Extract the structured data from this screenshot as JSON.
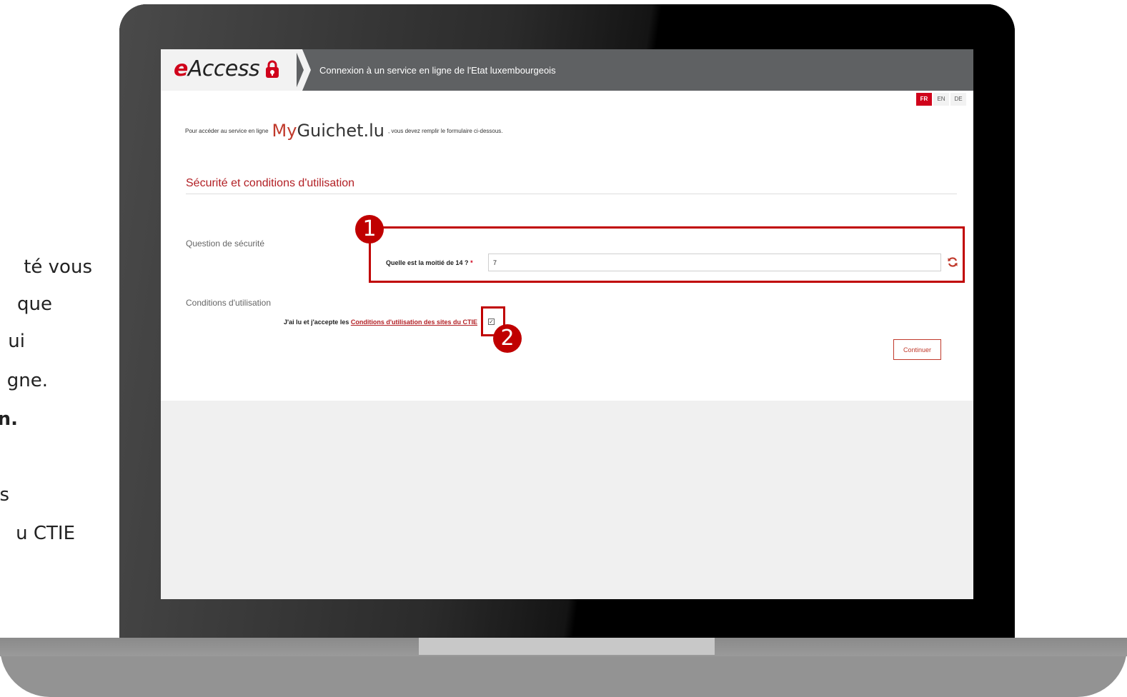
{
  "side_text": {
    "line1": "té vous",
    "line2": "que",
    "line3": "ui",
    "line4": "gne.",
    "line5": "n.",
    "line6": "s",
    "line7": "u CTIE"
  },
  "header": {
    "logo_text": "Access",
    "logo_e": "e",
    "title": "Connexion à un service en ligne de l'Etat luxembourgeois"
  },
  "languages": [
    {
      "code": "FR",
      "active": true
    },
    {
      "code": "EN",
      "active": false
    },
    {
      "code": "DE",
      "active": false
    }
  ],
  "intro": {
    "before": "Pour accéder au service en ligne",
    "brand_my": "My",
    "brand_rest": "Guichet.lu",
    "after": ", vous devez remplir le formulaire ci-dessous."
  },
  "section_title": "Sécurité et conditions d'utilisation",
  "security": {
    "label": "Question de sécurité",
    "question": "Quelle est la moitié de 14 ?",
    "required_mark": "*",
    "answer": "7",
    "refresh_icon": "refresh-icon"
  },
  "conditions": {
    "label": "Conditions d'utilisation",
    "text": "J'ai lu et j'accepte les",
    "link": "Conditions d'utilisation des sites du CTIE",
    "checked": true
  },
  "continue_label": "Continuer",
  "annotations": {
    "badge1": "1",
    "badge2": "2",
    "color": "#c00000"
  },
  "colors": {
    "brand_red": "#d0021b",
    "header_gray": "#5f6163",
    "section_red": "#b21f24"
  }
}
